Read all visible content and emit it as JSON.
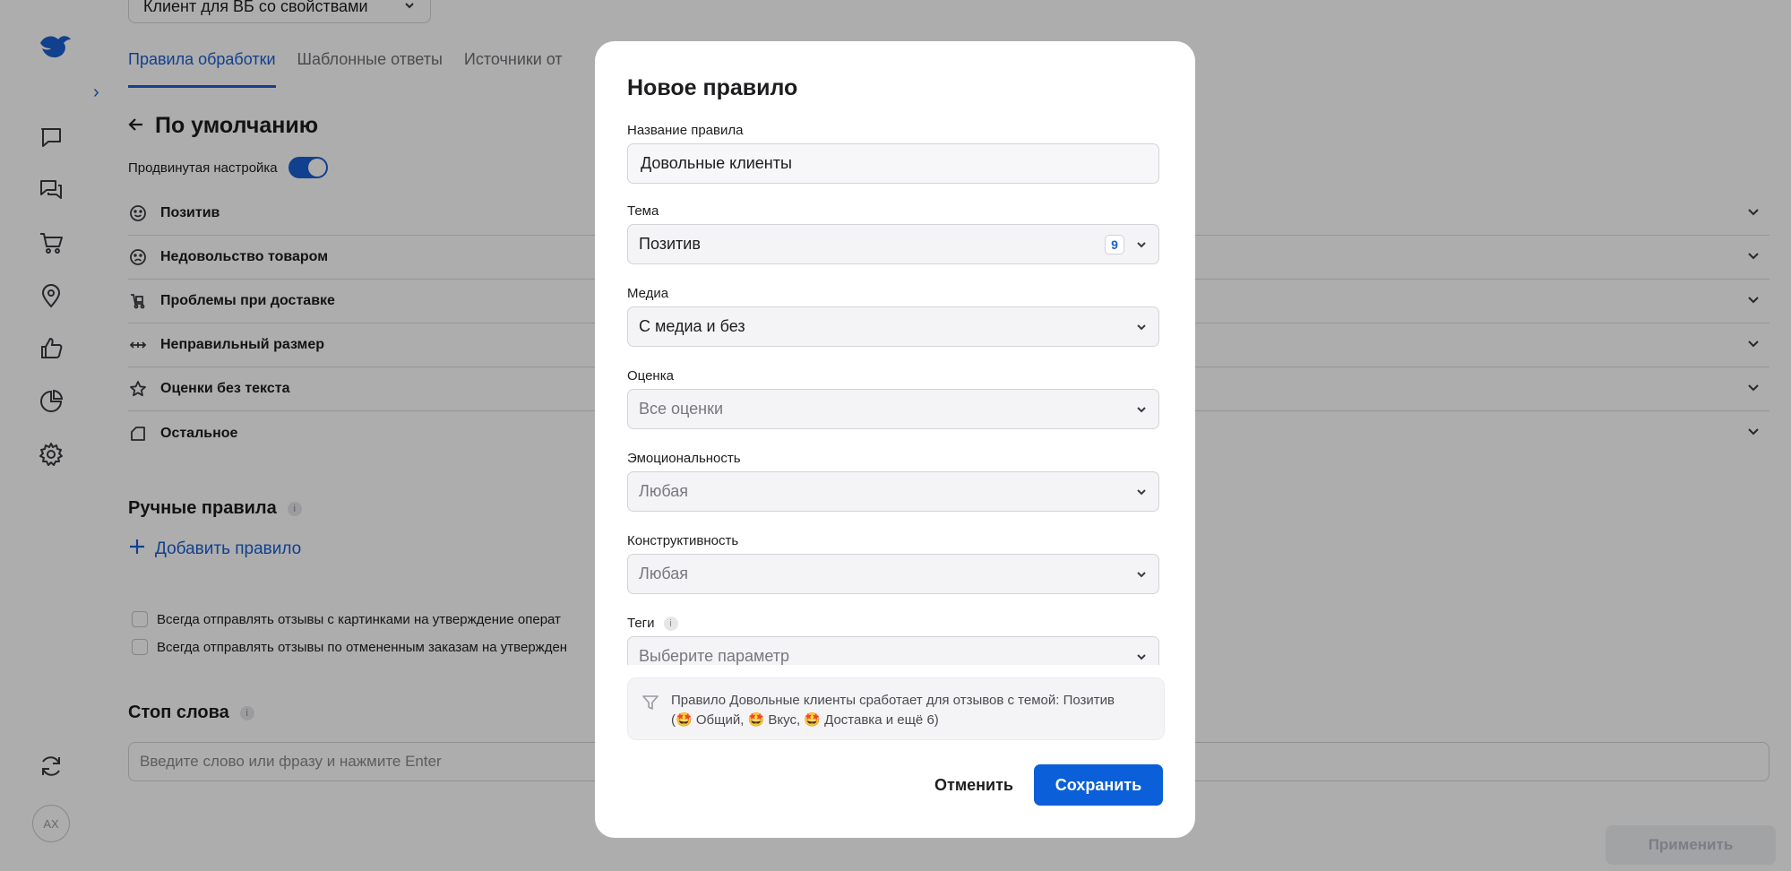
{
  "sidebar": {
    "avatar_initials": "AX",
    "icons": [
      "logo-icon",
      "chat-icon",
      "messages-icon",
      "cart-icon",
      "location-icon",
      "like-icon",
      "pie-chart-icon",
      "gear-icon",
      "refresh-icon"
    ]
  },
  "main": {
    "client_select": "Клиент для ВБ со свойствами",
    "tabs": [
      {
        "label": "Правила обработки",
        "active": true
      },
      {
        "label": "Шаблонные ответы",
        "active": false
      },
      {
        "label": "Источники от",
        "active": false
      }
    ],
    "page_title": "По умолчанию",
    "advanced_label": "Продвинутая настройка",
    "advanced_enabled": true,
    "topics": [
      {
        "label": "Позитив",
        "icon": "smile-icon"
      },
      {
        "label": "Недовольство товаром",
        "icon": "sad-face-icon"
      },
      {
        "label": "Проблемы при доставке",
        "icon": "delivery-cart-icon"
      },
      {
        "label": "Неправильный размер",
        "icon": "resize-arrows-icon"
      },
      {
        "label": "Оценки без текста",
        "icon": "star-icon"
      },
      {
        "label": "Остальное",
        "icon": "tag-icon"
      }
    ],
    "manual_rules_title": "Ручные правила",
    "add_rule_label": "Добавить правило",
    "checkboxes": [
      "Всегда отправлять отзывы с картинками на утверждение операт",
      "Всегда отправлять отзывы по отмененным заказам на утвержден"
    ],
    "stop_words_title": "Стоп слова",
    "stop_words_placeholder": "Введите слово или фразу и нажмите Enter",
    "apply_label": "Применить"
  },
  "modal": {
    "title": "Новое правило",
    "fields": {
      "name": {
        "label": "Название правила",
        "value": "Довольные клиенты"
      },
      "topic": {
        "label": "Тема",
        "value": "Позитив",
        "badge": "9"
      },
      "media": {
        "label": "Медиа",
        "value": "С медиа и без"
      },
      "rating": {
        "label": "Оценка",
        "placeholder": "Все оценки"
      },
      "emotion": {
        "label": "Эмоциональность",
        "placeholder": "Любая"
      },
      "constructive": {
        "label": "Конструктивность",
        "placeholder": "Любая"
      },
      "tags": {
        "label": "Теги",
        "placeholder": "Выберите параметр"
      }
    },
    "hint_line1": "Правило Довольные клиенты сработает для отзывов с темой: Позитив",
    "hint_line2": "(🤩 Общий, 🤩 Вкус, 🤩 Доставка и ещё 6)",
    "cancel_label": "Отменить",
    "save_label": "Сохранить"
  },
  "colors": {
    "accent": "#1a5fd1",
    "save_button": "#0b5fd8",
    "overlay": "rgba(0,0,0,0.32)"
  }
}
